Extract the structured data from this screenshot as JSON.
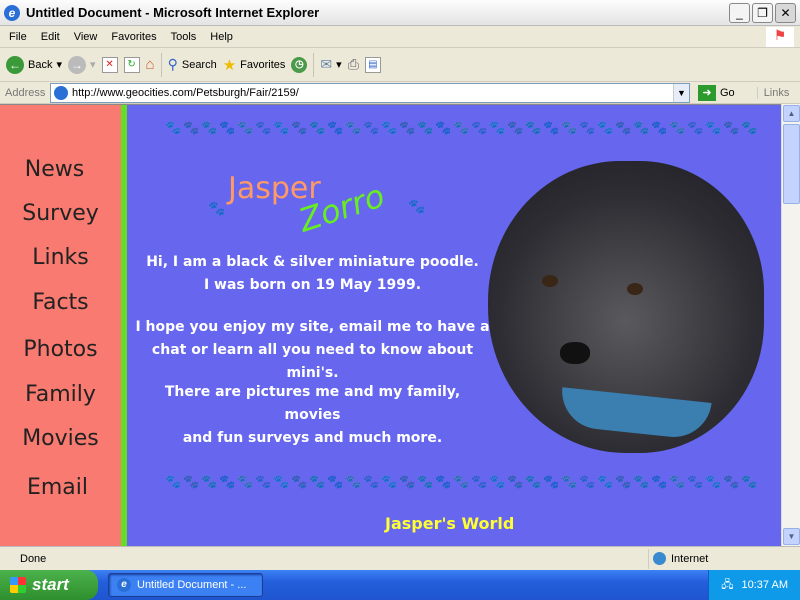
{
  "window": {
    "title": "Untitled Document - Microsoft Internet Explorer"
  },
  "menu": [
    "File",
    "Edit",
    "View",
    "Favorites",
    "Tools",
    "Help"
  ],
  "toolbar": {
    "back": "Back",
    "search": "Search",
    "favorites": "Favorites"
  },
  "address": {
    "label": "Address",
    "url": "http://www.geocities.com/Petsburgh/Fair/2159/",
    "go": "Go",
    "links": "Links"
  },
  "page": {
    "nav": [
      "News",
      "Survey",
      "Links",
      "Facts",
      "Photos",
      "Family",
      "Movies",
      "Email"
    ],
    "title_jasper": "Jasper",
    "title_zorro": "Zorro",
    "intro": [
      "Hi, I am a black & silver miniature poodle.",
      "I was born on 19 May 1999."
    ],
    "enjoy": [
      "I hope you enjoy my site, email me to have a",
      "chat or learn all you need to know about mini's."
    ],
    "more": [
      "There are pictures me and my family, movies",
      "and fun surveys and much more."
    ],
    "footer": "Jasper's World",
    "paw_colors": [
      "#33dddd",
      "#dd1111",
      "#22cc22",
      "#1111cc",
      "#eedd11",
      "#dd22dd"
    ]
  },
  "status": {
    "text": "Done",
    "zone": "Internet"
  },
  "taskbar": {
    "start": "start",
    "task": "Untitled Document - ...",
    "clock": "10:37 AM"
  }
}
